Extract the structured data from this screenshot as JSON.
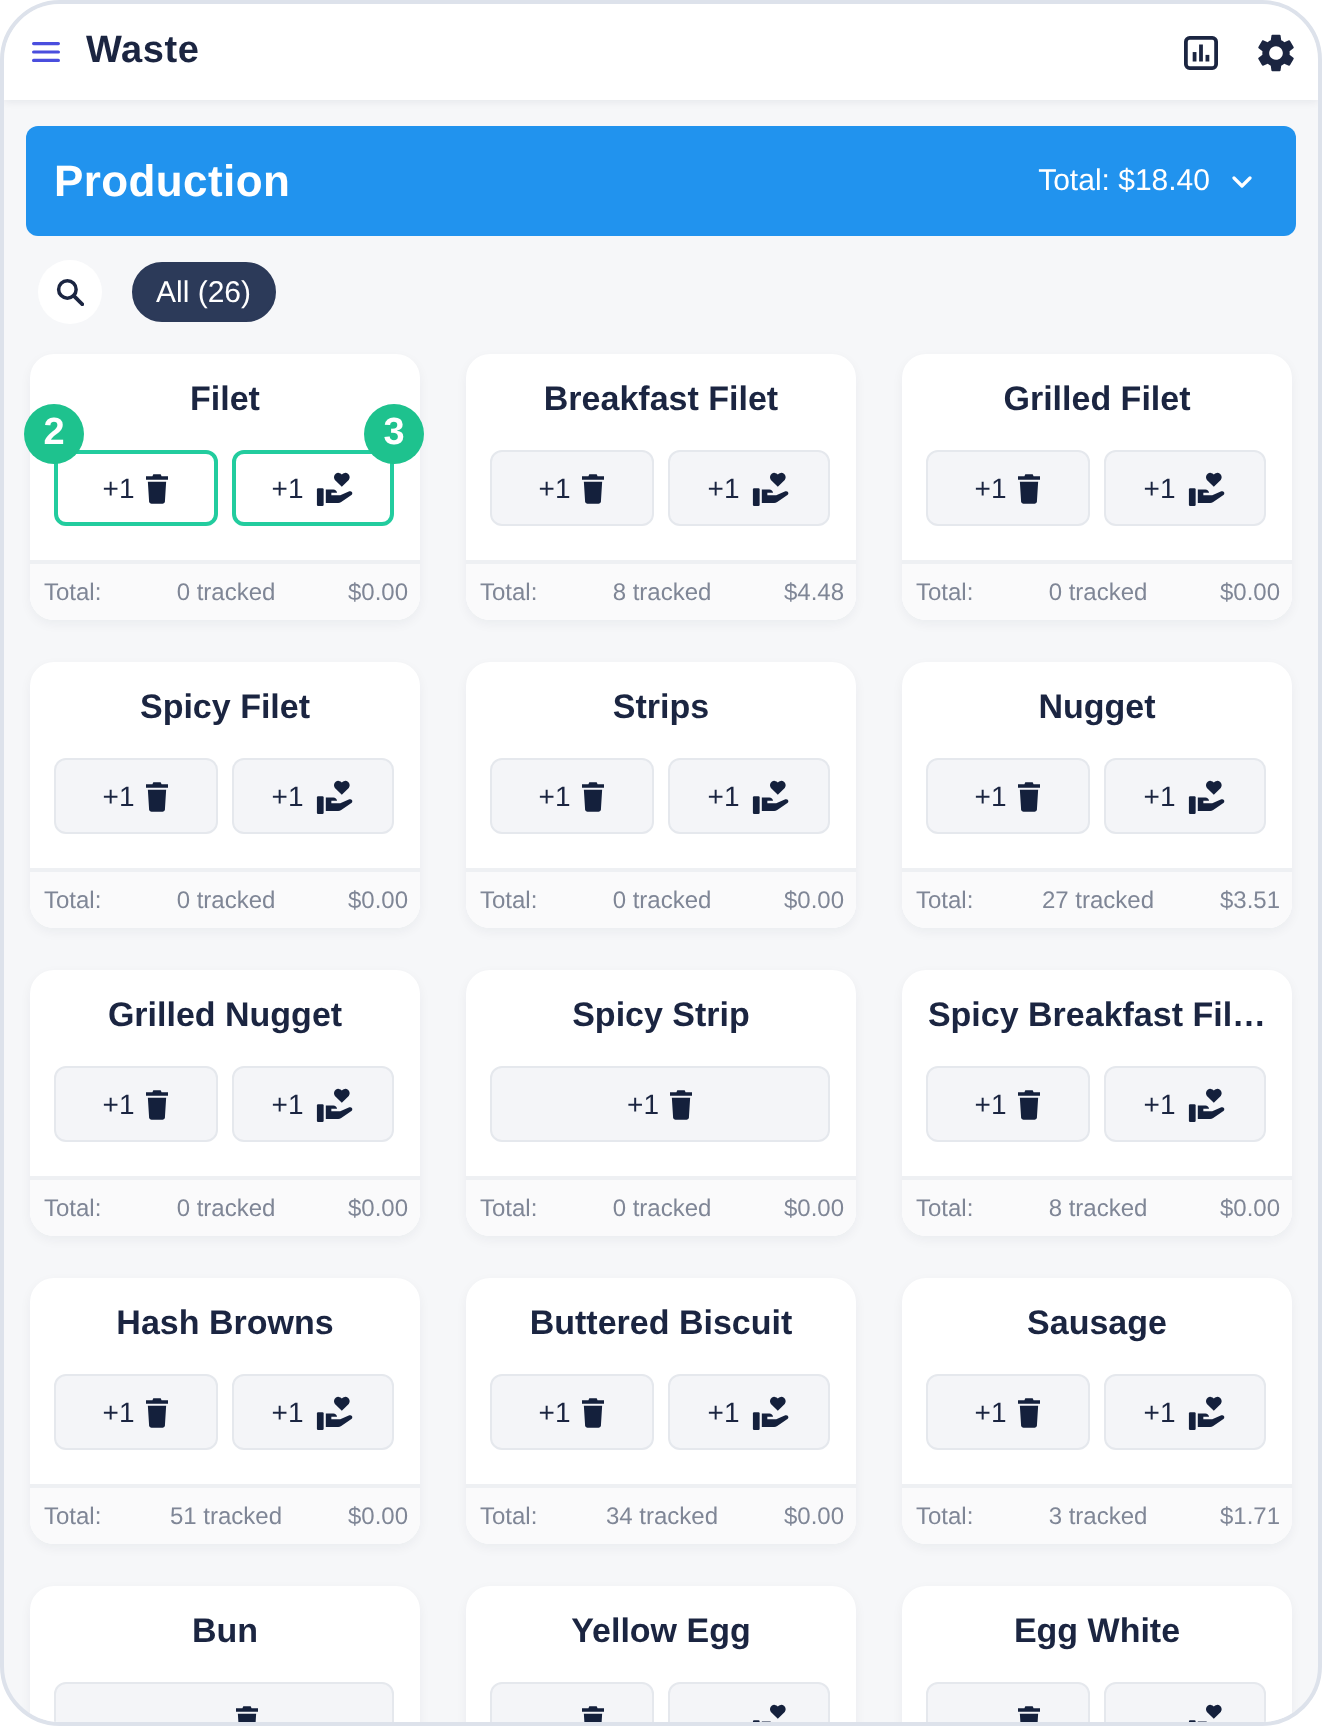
{
  "header": {
    "title": "Waste"
  },
  "banner": {
    "title": "Production",
    "total": "Total: $18.40"
  },
  "filters": [
    {
      "label": "All (26)",
      "selected": true
    }
  ],
  "items": [
    {
      "name": "Filet",
      "buttons": [
        {
          "kind": "waste",
          "label": "+1",
          "highlighted": true,
          "badge": "2"
        },
        {
          "kind": "donate",
          "label": "+1",
          "highlighted": true,
          "badge": "3"
        }
      ],
      "footer": {
        "label": "Total:",
        "tracked": "0 tracked",
        "amount": "$0.00"
      }
    },
    {
      "name": "Breakfast Filet",
      "buttons": [
        {
          "kind": "waste",
          "label": "+1",
          "highlighted": false
        },
        {
          "kind": "donate",
          "label": "+1",
          "highlighted": false
        }
      ],
      "footer": {
        "label": "Total:",
        "tracked": "8 tracked",
        "amount": "$4.48"
      }
    },
    {
      "name": "Grilled Filet",
      "buttons": [
        {
          "kind": "waste",
          "label": "+1",
          "highlighted": false
        },
        {
          "kind": "donate",
          "label": "+1",
          "highlighted": false
        }
      ],
      "footer": {
        "label": "Total:",
        "tracked": "0 tracked",
        "amount": "$0.00"
      }
    },
    {
      "name": "Spicy Filet",
      "buttons": [
        {
          "kind": "waste",
          "label": "+1",
          "highlighted": false
        },
        {
          "kind": "donate",
          "label": "+1",
          "highlighted": false
        }
      ],
      "footer": {
        "label": "Total:",
        "tracked": "0 tracked",
        "amount": "$0.00"
      }
    },
    {
      "name": "Strips",
      "buttons": [
        {
          "kind": "waste",
          "label": "+1",
          "highlighted": false
        },
        {
          "kind": "donate",
          "label": "+1",
          "highlighted": false
        }
      ],
      "footer": {
        "label": "Total:",
        "tracked": "0 tracked",
        "amount": "$0.00"
      }
    },
    {
      "name": "Nugget",
      "buttons": [
        {
          "kind": "waste",
          "label": "+1",
          "highlighted": false
        },
        {
          "kind": "donate",
          "label": "+1",
          "highlighted": false
        }
      ],
      "footer": {
        "label": "Total:",
        "tracked": "27 tracked",
        "amount": "$3.51"
      }
    },
    {
      "name": "Grilled Nugget",
      "buttons": [
        {
          "kind": "waste",
          "label": "+1",
          "highlighted": false
        },
        {
          "kind": "donate",
          "label": "+1",
          "highlighted": false
        }
      ],
      "footer": {
        "label": "Total:",
        "tracked": "0 tracked",
        "amount": "$0.00"
      }
    },
    {
      "name": "Spicy Strip",
      "buttons": [
        {
          "kind": "waste",
          "label": "+1",
          "highlighted": false
        }
      ],
      "footer": {
        "label": "Total:",
        "tracked": "0 tracked",
        "amount": "$0.00"
      }
    },
    {
      "name": "Spicy Breakfast Fil…",
      "buttons": [
        {
          "kind": "waste",
          "label": "+1",
          "highlighted": false
        },
        {
          "kind": "donate",
          "label": "+1",
          "highlighted": false
        }
      ],
      "footer": {
        "label": "Total:",
        "tracked": "8 tracked",
        "amount": "$0.00"
      }
    },
    {
      "name": "Hash Browns",
      "buttons": [
        {
          "kind": "waste",
          "label": "+1",
          "highlighted": false
        },
        {
          "kind": "donate",
          "label": "+1",
          "highlighted": false
        }
      ],
      "footer": {
        "label": "Total:",
        "tracked": "51 tracked",
        "amount": "$0.00"
      }
    },
    {
      "name": "Buttered Biscuit",
      "buttons": [
        {
          "kind": "waste",
          "label": "+1",
          "highlighted": false
        },
        {
          "kind": "donate",
          "label": "+1",
          "highlighted": false
        }
      ],
      "footer": {
        "label": "Total:",
        "tracked": "34 tracked",
        "amount": "$0.00"
      }
    },
    {
      "name": "Sausage",
      "buttons": [
        {
          "kind": "waste",
          "label": "+1",
          "highlighted": false
        },
        {
          "kind": "donate",
          "label": "+1",
          "highlighted": false
        }
      ],
      "footer": {
        "label": "Total:",
        "tracked": "3 tracked",
        "amount": "$1.71"
      }
    },
    {
      "name": "Bun",
      "buttons": [
        {
          "kind": "waste",
          "highlighted": false
        }
      ]
    },
    {
      "name": "Yellow Egg",
      "buttons": [
        {
          "kind": "waste",
          "highlighted": false
        },
        {
          "kind": "donate",
          "highlighted": false
        }
      ]
    },
    {
      "name": "Egg White",
      "buttons": [
        {
          "kind": "waste",
          "highlighted": false
        },
        {
          "kind": "donate",
          "highlighted": false
        }
      ]
    }
  ]
}
